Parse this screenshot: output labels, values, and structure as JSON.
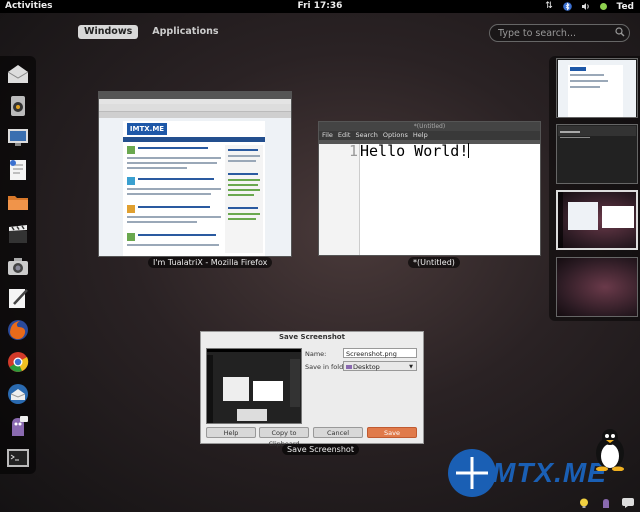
{
  "top_panel": {
    "activities": "Activities",
    "clock": "Fri 17:36",
    "user": "Ted",
    "icons": [
      "network-arrows-icon",
      "bluetooth-icon",
      "volume-icon",
      "user-status-icon"
    ]
  },
  "view_selector": {
    "tabs": [
      {
        "label": "Windows",
        "active": true
      },
      {
        "label": "Applications",
        "active": false
      }
    ]
  },
  "search": {
    "placeholder": "Type to search..."
  },
  "dash": {
    "items": [
      "mail-envelope-icon",
      "speaker-icon",
      "screenshot-monitor-icon",
      "text-editor-icon",
      "file-manager-folder-icon",
      "movie-clapper-icon",
      "camera-icon",
      "pen-editor-icon",
      "firefox-icon",
      "chrome-icon",
      "thunderbird-icon",
      "pidgin-icon",
      "terminal-icon"
    ]
  },
  "windows": [
    {
      "caption": "I'm TualatriX - Mozilla Firefox",
      "app": "firefox",
      "site_logo": "IMTX.ME"
    },
    {
      "caption": "*(Untitled)",
      "app": "gedit",
      "window_title": "*(Untitled)",
      "menu": [
        "File",
        "Edit",
        "Search",
        "Options",
        "Help"
      ],
      "line_number": "1",
      "content": "Hello World!"
    }
  ],
  "workspaces": {
    "count": 4,
    "active_index": 2
  },
  "dialog": {
    "title": "Save Screenshot",
    "caption": "Save Screenshot",
    "name_label": "Name:",
    "name_value": "Screenshot.png",
    "folder_label": "Save in folder:",
    "folder_value": "Desktop",
    "buttons": [
      "Help",
      "Copy to Clipboard",
      "Cancel",
      "Save"
    ]
  },
  "watermark": {
    "text": "MTX.ME"
  },
  "colors": {
    "panel": "#000000",
    "save_button": "#e07a4a",
    "watermark_blue": "#1a5fb4",
    "background_dark": "#1a1517"
  }
}
